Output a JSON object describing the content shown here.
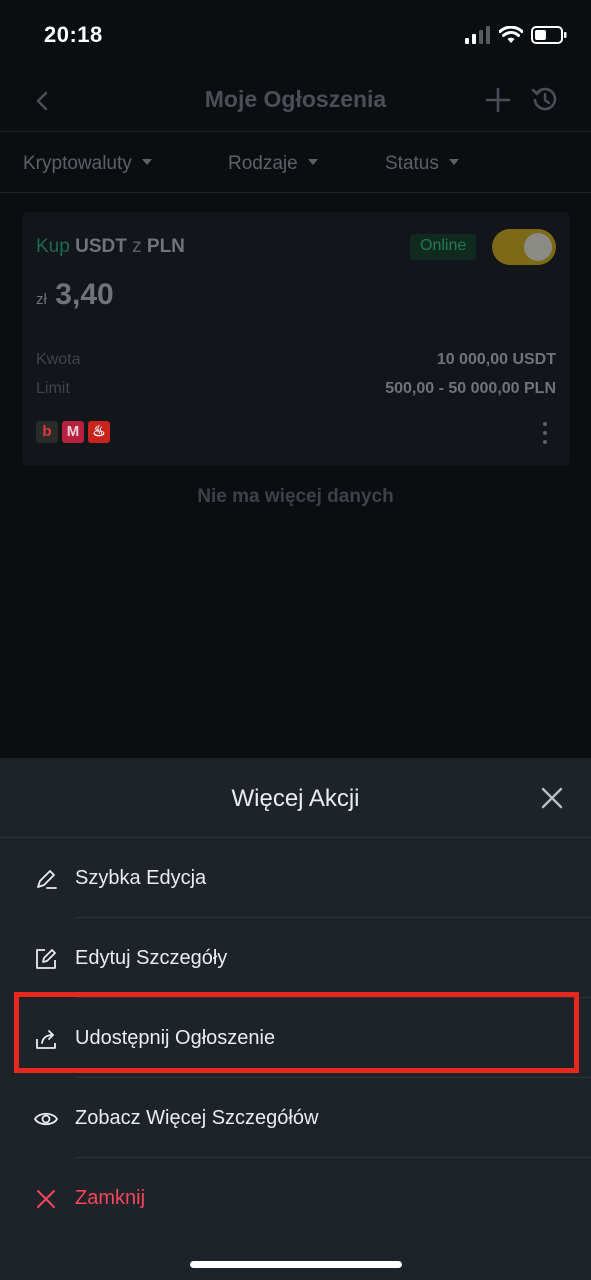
{
  "status_bar": {
    "time": "20:18"
  },
  "header": {
    "title": "Moje Ogłoszenia"
  },
  "filters": [
    {
      "label": "Kryptowaluty"
    },
    {
      "label": "Rodzaje"
    },
    {
      "label": "Status"
    }
  ],
  "ad": {
    "side": "Kup",
    "asset": "USDT",
    "connector": "z",
    "fiat": "PLN",
    "status_badge": "Online",
    "toggle_on": true,
    "price_currency": "zł",
    "price": "3,40",
    "amount_label": "Kwota",
    "amount_value": "10 000,00 USDT",
    "limit_label": "Limit",
    "limit_value": "500,00 - 50 000,00 PLN",
    "payment_methods": [
      {
        "icon": "blik-icon",
        "glyph": "b",
        "bg": "#2a2a2a",
        "fg": "#e23a3a"
      },
      {
        "icon": "mbank-icon",
        "glyph": "M",
        "bg": "#b5213f",
        "fg": "#f0d0d8"
      },
      {
        "icon": "santander-icon",
        "glyph": "♨",
        "bg": "#c8231d",
        "fg": "#ffffff"
      }
    ]
  },
  "list_end_text": "Nie ma więcej danych",
  "sheet": {
    "title": "Więcej Akcji",
    "actions": [
      {
        "label": "Szybka Edycja",
        "icon": "pen-edit-icon"
      },
      {
        "label": "Edytuj Szczegóły",
        "icon": "edit-square-icon"
      },
      {
        "label": "Udostępnij Ogłoszenie",
        "icon": "share-icon"
      },
      {
        "label": "Zobacz Więcej Szczegółów",
        "icon": "eye-icon"
      },
      {
        "label": "Zamknij",
        "icon": "close-x-icon"
      }
    ]
  },
  "colors": {
    "background": "#0b0e11",
    "sheet_background": "#1e2329",
    "danger": "#f6465d",
    "highlight": "#e8271f",
    "toggle": "#7c6a17"
  }
}
